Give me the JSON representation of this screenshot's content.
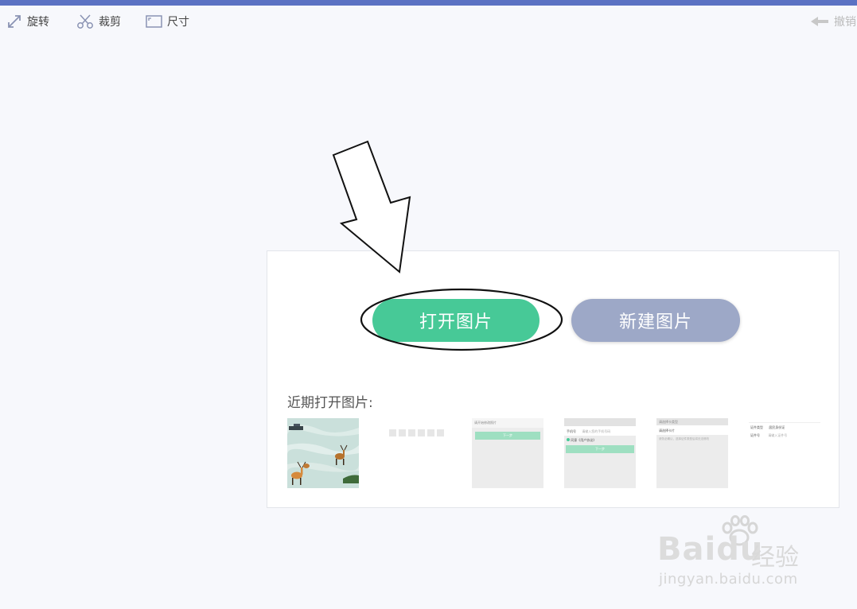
{
  "toolbar": {
    "rotate_label": "旋转",
    "crop_label": "裁剪",
    "size_label": "尺寸",
    "undo_label": "撤销"
  },
  "panel": {
    "open_button_label": "打开图片",
    "new_button_label": "新建图片",
    "recent_label": "近期打开图片:"
  },
  "recent_images": [
    {
      "name": "deer-photo"
    },
    {
      "name": "blank-squares"
    },
    {
      "name": "form-screenshot-1",
      "header_text": "请开始修改照片",
      "button_text": "下一步"
    },
    {
      "name": "form-screenshot-2",
      "field_label": "手机号",
      "field_placeholder": "请输入您的手机号码",
      "check_text": "同意《用户协议》",
      "button_text": "下一步"
    },
    {
      "name": "form-screenshot-3",
      "header_text": "请选择卡类型",
      "row_text": "请选择卡片",
      "note_text": "请务必确认，选择证件类型后将无法修改"
    },
    {
      "name": "form-screenshot-4",
      "row1_label": "证件类型",
      "row1_value": "居民身份证",
      "row2_label": "证件号",
      "row2_value": "请输入证件号"
    }
  ],
  "watermark": {
    "logo_text": "Baidu",
    "cn_text": "经验",
    "url_text": "jingyan.baidu.com"
  },
  "colors": {
    "open_button": "#47c997",
    "new_button": "#9da8c7",
    "top_strip": "#5b72c3"
  }
}
